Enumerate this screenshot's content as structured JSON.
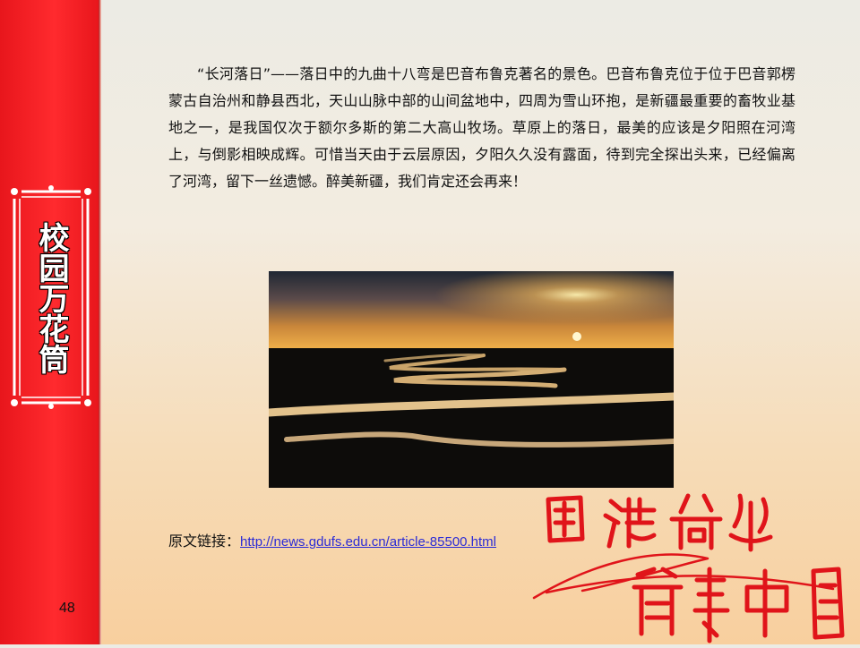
{
  "sidebar": {
    "title": "校园万花筒",
    "page_number": "48",
    "color": "#e8161c"
  },
  "article": {
    "paragraph": "“长河落日”——落日中的九曲十八弯是巴音布鲁克著名的景色。巴音布鲁克位于位于巴音郭楞蒙古自治州和静县西北，天山山脉中部的山间盆地中，四周为雪山环抱，是新疆最重要的畜牧业基地之一，是我国仅次于额尔多斯的第二大高山牧场。草原上的落日，最美的应该是夕阳照在河湾上，与倒影相映成辉。可惜当天由于云层原因，夕阳久久没有露面，待到完全探出头来，已经偏离了河湾，留下一丝遗憾。醉美新疆，我们肯定还会再来！"
  },
  "photo": {
    "subject": "sunset-over-winding-river"
  },
  "source": {
    "label": "原文链接：",
    "url": "http://news.gdufs.edu.cn/article-85500.html"
  },
  "decoration": {
    "seal_text": "明德尚行 学贯中西",
    "seal_color": "#e0141a"
  }
}
